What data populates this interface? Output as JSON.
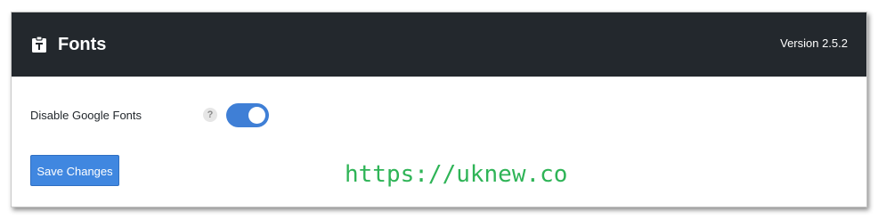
{
  "header": {
    "title": "Fonts",
    "version": "Version 2.5.2",
    "icon": "clipboard-font-icon"
  },
  "settings": {
    "disable_google_fonts": {
      "label": "Disable Google Fonts",
      "help": "?",
      "enabled": true
    }
  },
  "actions": {
    "save_label": "Save Changes"
  },
  "watermark": {
    "text": "https://uknew.co"
  },
  "colors": {
    "header_bg": "#23282d",
    "accent": "#3f7fd6",
    "button": "#4087e0",
    "watermark": "#2fb457"
  }
}
